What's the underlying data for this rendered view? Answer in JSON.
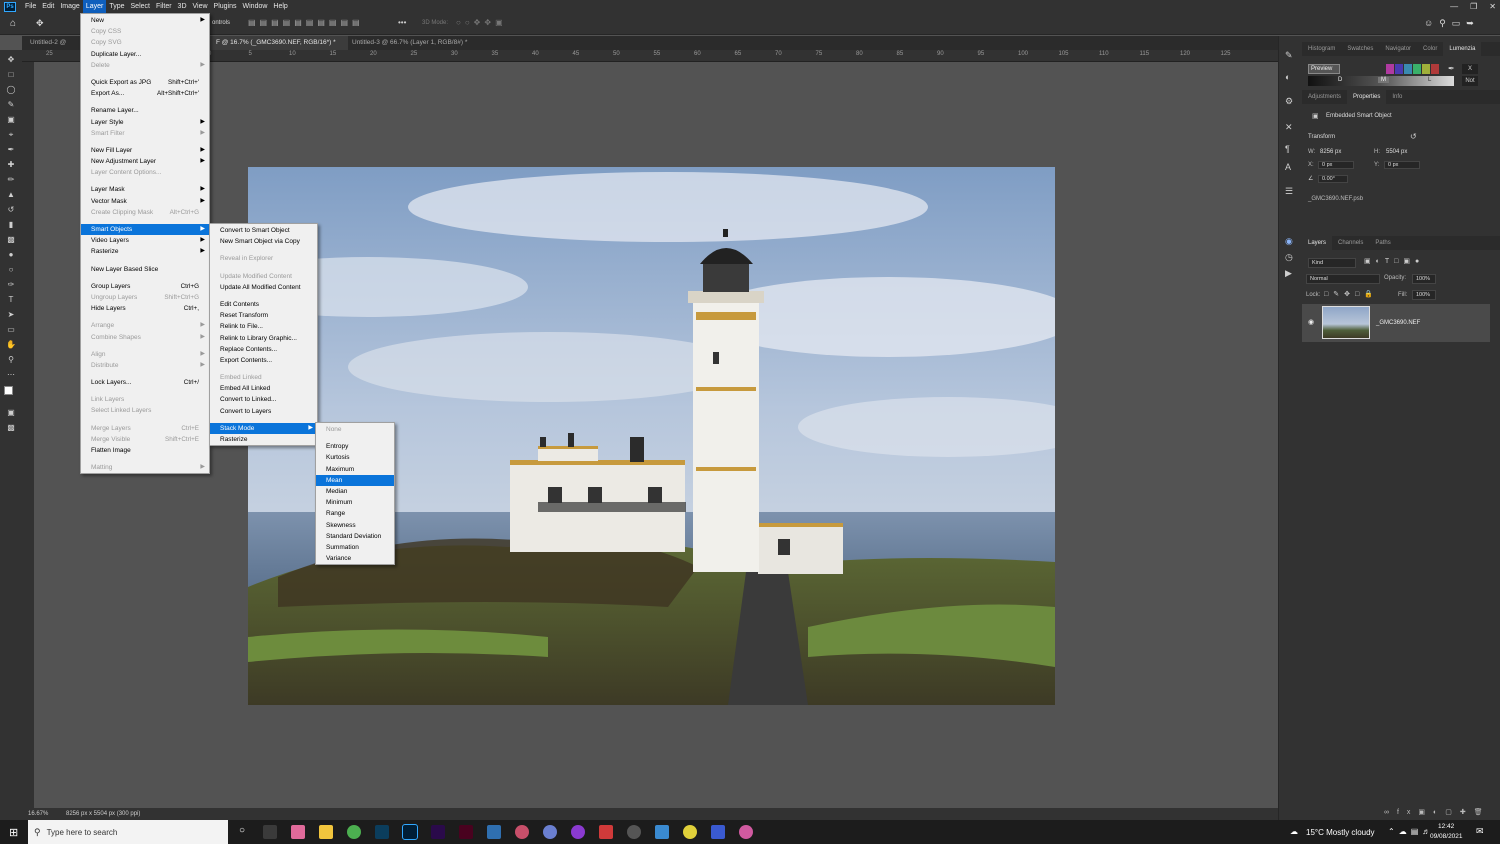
{
  "menubar": {
    "items": [
      "File",
      "Edit",
      "Image",
      "Layer",
      "Type",
      "Select",
      "Filter",
      "3D",
      "View",
      "Plugins",
      "Window",
      "Help"
    ],
    "logo": "Ps",
    "open": "Layer"
  },
  "options": {
    "controls": "ontrols",
    "mode3d": "3D Mode:"
  },
  "tabs": [
    {
      "label": "Untitled-2 @ ..."
    },
    {
      "label": "F @ 16.7% (_GMC3690.NEF, RGB/16*) *"
    },
    {
      "label": "Untitled-3 @ 66.7% (Layer 1, RGB/8#) *"
    }
  ],
  "ruler": {
    "top": [
      "25",
      "0",
      "25",
      "50",
      "0",
      "5",
      "10",
      "15",
      "20",
      "25",
      "30",
      "35",
      "40",
      "45",
      "50",
      "55",
      "60",
      "65",
      "70",
      "75",
      "80",
      "85",
      "90",
      "95",
      "100",
      "105",
      "110",
      "115",
      "120",
      "125"
    ]
  },
  "status": {
    "zoom": "16.67%",
    "info": "8256 px x 5504 px (300 ppi)"
  },
  "layer_menu": [
    {
      "label": "New",
      "arrow": true
    },
    {
      "label": "Copy CSS",
      "disabled": true
    },
    {
      "label": "Copy SVG",
      "disabled": true
    },
    {
      "label": "Duplicate Layer..."
    },
    {
      "label": "Delete",
      "disabled": true,
      "arrow": true
    },
    {
      "sep": true
    },
    {
      "label": "Quick Export as JPG",
      "shortcut": "Shift+Ctrl+'"
    },
    {
      "label": "Export As...",
      "shortcut": "Alt+Shift+Ctrl+'"
    },
    {
      "sep": true
    },
    {
      "label": "Rename Layer..."
    },
    {
      "label": "Layer Style",
      "arrow": true
    },
    {
      "label": "Smart Filter",
      "disabled": true,
      "arrow": true
    },
    {
      "sep": true
    },
    {
      "label": "New Fill Layer",
      "arrow": true
    },
    {
      "label": "New Adjustment Layer",
      "arrow": true
    },
    {
      "label": "Layer Content Options...",
      "disabled": true
    },
    {
      "sep": true
    },
    {
      "label": "Layer Mask",
      "arrow": true
    },
    {
      "label": "Vector Mask",
      "arrow": true
    },
    {
      "label": "Create Clipping Mask",
      "disabled": true,
      "shortcut": "Alt+Ctrl+G"
    },
    {
      "sep": true
    },
    {
      "label": "Smart Objects",
      "arrow": true,
      "highlight": true
    },
    {
      "label": "Video Layers",
      "arrow": true
    },
    {
      "label": "Rasterize",
      "arrow": true
    },
    {
      "sep": true
    },
    {
      "label": "New Layer Based Slice"
    },
    {
      "sep": true
    },
    {
      "label": "Group Layers",
      "shortcut": "Ctrl+G"
    },
    {
      "label": "Ungroup Layers",
      "disabled": true,
      "shortcut": "Shift+Ctrl+G"
    },
    {
      "label": "Hide Layers",
      "shortcut": "Ctrl+,"
    },
    {
      "sep": true
    },
    {
      "label": "Arrange",
      "disabled": true,
      "arrow": true
    },
    {
      "label": "Combine Shapes",
      "disabled": true,
      "arrow": true
    },
    {
      "sep": true
    },
    {
      "label": "Align",
      "disabled": true,
      "arrow": true
    },
    {
      "label": "Distribute",
      "disabled": true,
      "arrow": true
    },
    {
      "sep": true
    },
    {
      "label": "Lock Layers...",
      "shortcut": "Ctrl+/"
    },
    {
      "sep": true
    },
    {
      "label": "Link Layers",
      "disabled": true
    },
    {
      "label": "Select Linked Layers",
      "disabled": true
    },
    {
      "sep": true
    },
    {
      "label": "Merge Layers",
      "disabled": true,
      "shortcut": "Ctrl+E"
    },
    {
      "label": "Merge Visible",
      "disabled": true,
      "shortcut": "Shift+Ctrl+E"
    },
    {
      "label": "Flatten Image"
    },
    {
      "sep": true
    },
    {
      "label": "Matting",
      "disabled": true,
      "arrow": true
    }
  ],
  "smart_menu": [
    {
      "label": "Convert to Smart Object"
    },
    {
      "label": "New Smart Object via Copy"
    },
    {
      "sep": true
    },
    {
      "label": "Reveal in Explorer",
      "disabled": true
    },
    {
      "sep": true
    },
    {
      "label": "Update Modified Content",
      "disabled": true
    },
    {
      "label": "Update All Modified Content"
    },
    {
      "sep": true
    },
    {
      "label": "Edit Contents"
    },
    {
      "label": "Reset Transform"
    },
    {
      "label": "Relink to File..."
    },
    {
      "label": "Relink to Library Graphic..."
    },
    {
      "label": "Replace Contents..."
    },
    {
      "label": "Export Contents..."
    },
    {
      "sep": true
    },
    {
      "label": "Embed Linked",
      "disabled": true
    },
    {
      "label": "Embed All Linked"
    },
    {
      "label": "Convert to Linked..."
    },
    {
      "label": "Convert to Layers"
    },
    {
      "sep": true
    },
    {
      "label": "Stack Mode",
      "arrow": true,
      "highlight": true
    },
    {
      "label": "Rasterize"
    }
  ],
  "stack_menu": [
    {
      "label": "None",
      "disabled": true
    },
    {
      "sep": true
    },
    {
      "label": "Entropy"
    },
    {
      "label": "Kurtosis"
    },
    {
      "label": "Maximum"
    },
    {
      "label": "Mean",
      "highlight": true
    },
    {
      "label": "Median"
    },
    {
      "label": "Minimum"
    },
    {
      "label": "Range"
    },
    {
      "label": "Skewness"
    },
    {
      "label": "Standard Deviation"
    },
    {
      "label": "Summation"
    },
    {
      "label": "Variance"
    }
  ],
  "panels": {
    "top_tabs": [
      "Histogram",
      "Swatches",
      "Navigator",
      "Color",
      "Lumenzia"
    ],
    "lumenzia": {
      "preview": "Preview",
      "d": "D",
      "m": "M",
      "l": "L",
      "not": "Not",
      "x": "X"
    },
    "mid_tabs": [
      "Adjustments",
      "Properties",
      "Info"
    ],
    "props": {
      "type": "Embedded Smart Object",
      "transform": "Transform",
      "w_label": "W:",
      "w": "8256 px",
      "h_label": "H:",
      "h": "5504 px",
      "x_label": "X:",
      "x": "0 px",
      "y_label": "Y:",
      "y": "0 px",
      "angle": "0.00°",
      "file": "_GMC3690.NEF.psb"
    },
    "layer_tabs": [
      "Layers",
      "Channels",
      "Paths"
    ],
    "kind": "Kind",
    "blend": "Normal",
    "opacity_label": "Opacity:",
    "opacity": "100%",
    "lock_label": "Lock:",
    "fill_label": "Fill:",
    "fill": "100%",
    "layer_name": "_GMC3690.NEF"
  },
  "taskbar": {
    "search": "Type here to search",
    "weather": "15°C  Mostly cloudy",
    "time": "12:42",
    "date": "09/08/2021"
  },
  "colors": {
    "accent": "#0a74da",
    "bg": "#535353",
    "panel": "#323232"
  }
}
